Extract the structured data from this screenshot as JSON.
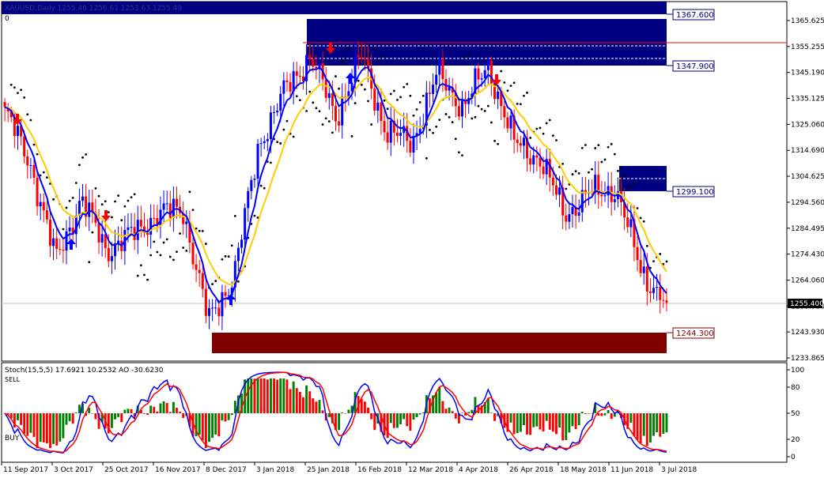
{
  "chart": {
    "header": "XAUUSD,Daily 1255.40 1256.61 1253.63 1255.49",
    "corner_zero": "0",
    "price_labels": [
      "1365.625",
      "1355.255",
      "1345.190",
      "1335.125",
      "1325.060",
      "1314.690",
      "1304.625",
      "1294.560",
      "1284.495",
      "1274.430",
      "1264.060",
      "1253.930",
      "1243.930",
      "1233.865"
    ],
    "current_price": "1255.400",
    "levels": {
      "top_high": "1367.600",
      "top_low": "1347.900",
      "mid_low": "1299.100",
      "bottom_high": "1244.300"
    },
    "colors": {
      "bull": "#0000ff",
      "bear": "#ff0000",
      "ma_fast": "#0000ff",
      "ma_slow": "#ffcc00",
      "zone_top": "#000080",
      "zone_bottom": "#800000",
      "psar": "#000000",
      "resistance_line": "#ff0000"
    }
  },
  "indicator": {
    "header": "Stoch(15,5,5) 17.6921 10.2532  AO -30.6230",
    "sell_label": "SELL",
    "buy_label": "BUY",
    "scale_labels": [
      "100",
      "80",
      "50",
      "20",
      "0"
    ]
  },
  "x_axis": {
    "labels": [
      "11 Sep 2017",
      "3 Oct 2017",
      "25 Oct 2017",
      "16 Nov 2017",
      "8 Dec 2017",
      "3 Jan 2018",
      "25 Jan 2018",
      "16 Feb 2018",
      "12 Mar 2018",
      "4 Apr 2018",
      "26 Apr 2018",
      "18 May 2018",
      "11 Jun 2018",
      "3 Jul 2018"
    ]
  },
  "chart_data": {
    "type": "candlestick",
    "instrument": "XAUUSD",
    "timeframe": "Daily",
    "x_range": [
      "11 Sep 2017",
      "3 Jul 2018"
    ],
    "y_range": [
      1233.865,
      1365.625
    ],
    "last_price": 1255.4,
    "zones": [
      {
        "name": "resistance",
        "low": 1347.9,
        "high": 1367.6
      },
      {
        "name": "mid",
        "low": 1299.1,
        "high": 1309
      },
      {
        "name": "support",
        "low": 1235,
        "high": 1244.3
      }
    ],
    "close_path": [
      [
        "11 Sep 2017",
        1330
      ],
      [
        "20 Sep 2017",
        1310
      ],
      [
        "3 Oct 2017",
        1272
      ],
      [
        "12 Oct 2017",
        1296
      ],
      [
        "25 Oct 2017",
        1276
      ],
      [
        "5 Nov 2017",
        1282
      ],
      [
        "16 Nov 2017",
        1290
      ],
      [
        "27 Nov 2017",
        1292
      ],
      [
        "8 Dec 2017",
        1248
      ],
      [
        "20 Dec 2017",
        1266
      ],
      [
        "3 Jan 2018",
        1318
      ],
      [
        "12 Jan 2018",
        1338
      ],
      [
        "25 Jan 2018",
        1352
      ],
      [
        "5 Feb 2018",
        1328
      ],
      [
        "16 Feb 2018",
        1352
      ],
      [
        "26 Feb 2018",
        1322
      ],
      [
        "12 Mar 2018",
        1318
      ],
      [
        "22 Mar 2018",
        1345
      ],
      [
        "4 Apr 2018",
        1332
      ],
      [
        "13 Apr 2018",
        1348
      ],
      [
        "26 Apr 2018",
        1318
      ],
      [
        "7 May 2018",
        1312
      ],
      [
        "18 May 2018",
        1290
      ],
      [
        "30 May 2018",
        1298
      ],
      [
        "11 Jun 2018",
        1300
      ],
      [
        "20 Jun 2018",
        1268
      ],
      [
        "3 Jul 2018",
        1255
      ]
    ]
  }
}
